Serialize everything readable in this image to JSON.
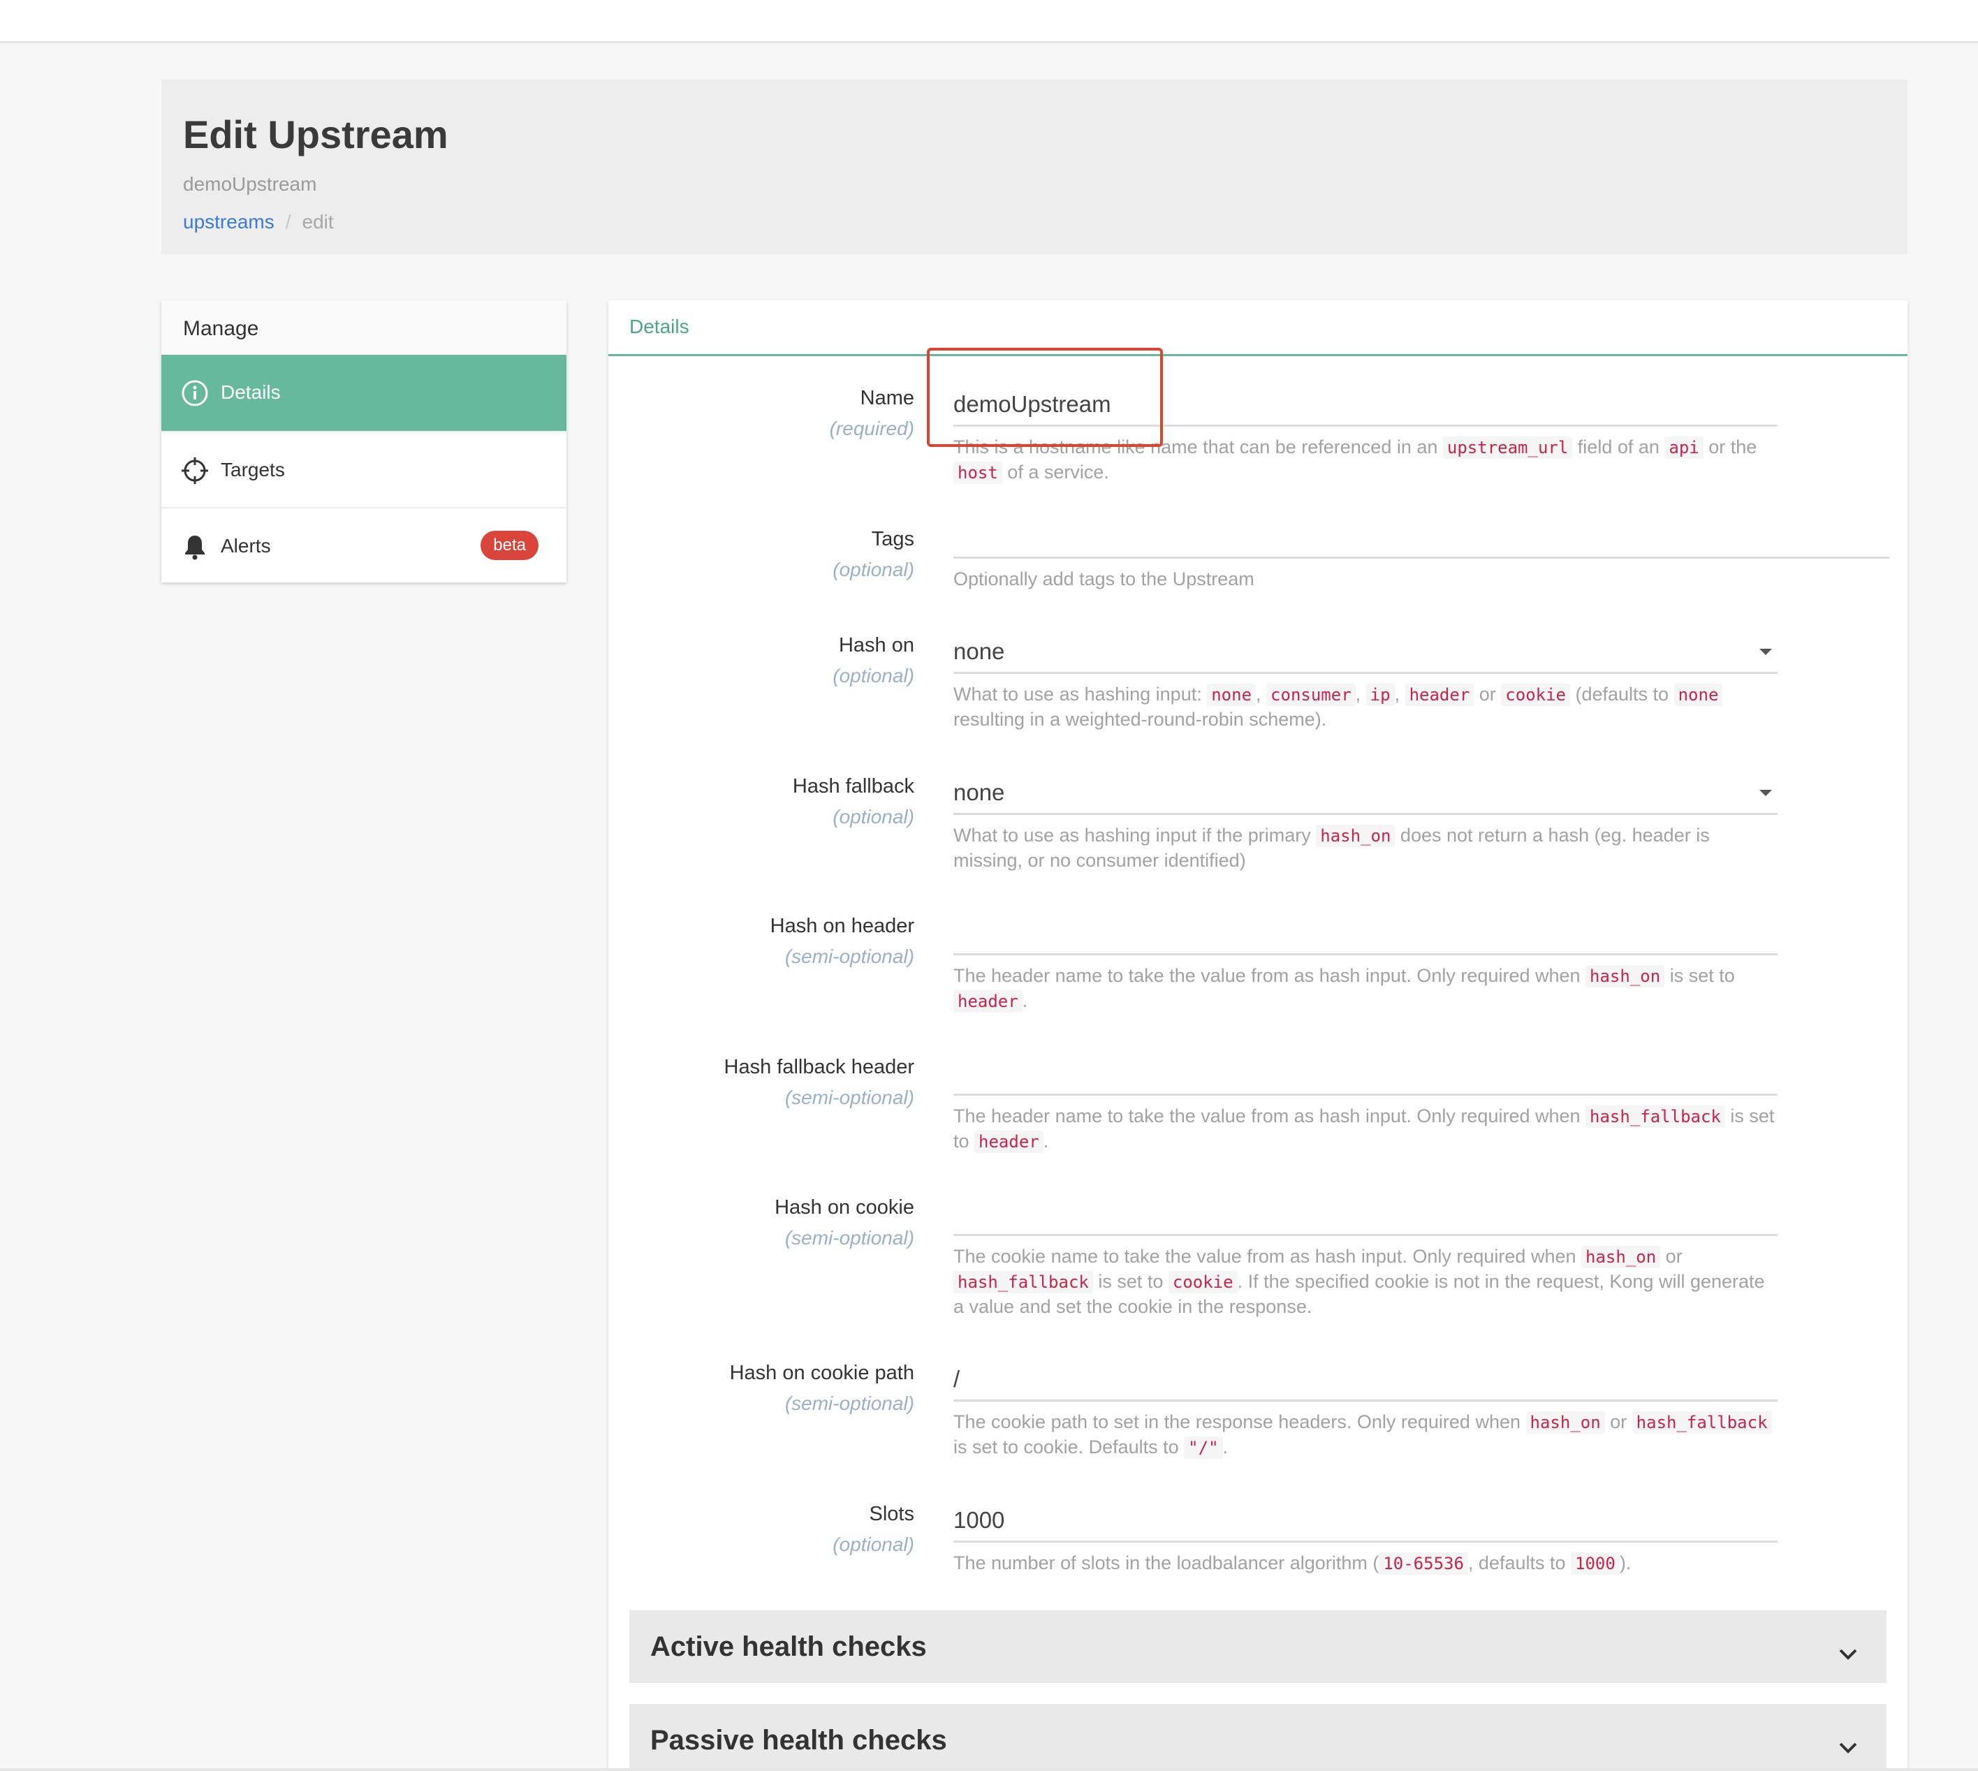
{
  "header": {
    "title": "Edit Upstream",
    "subtitle": "demoUpstream",
    "breadcrumb": {
      "link": "upstreams",
      "separator": "/",
      "current": "edit"
    }
  },
  "sidebar": {
    "heading": "Manage",
    "items": [
      {
        "label": "Details",
        "icon": "info-icon",
        "active": true
      },
      {
        "label": "Targets",
        "icon": "crosshair-icon"
      },
      {
        "label": "Alerts",
        "icon": "bell-icon",
        "badge": "beta"
      }
    ]
  },
  "tab": {
    "label": "Details"
  },
  "fields": {
    "name": {
      "label": "Name",
      "req": "(required)",
      "value": "demoUpstream",
      "help": [
        "This is a hostname like name that can be referenced in an ",
        "upstream_url",
        " field of an ",
        "api",
        " or the ",
        "host",
        " of a service."
      ]
    },
    "tags": {
      "label": "Tags",
      "req": "(optional)",
      "value": "",
      "help": "Optionally add tags to the Upstream"
    },
    "hash_on": {
      "label": "Hash on",
      "req": "(optional)",
      "value": "none",
      "help": [
        "What to use as hashing input: ",
        "none",
        ", ",
        "consumer",
        ", ",
        "ip",
        ", ",
        "header",
        " or ",
        "cookie",
        " (defaults to ",
        "none",
        " resulting in a weighted-round-robin scheme)."
      ]
    },
    "hash_fallback": {
      "label": "Hash fallback",
      "req": "(optional)",
      "value": "none",
      "help": [
        "What to use as hashing input if the primary ",
        "hash_on",
        " does not return a hash (eg. header is missing, or no consumer identified)"
      ]
    },
    "hash_on_header": {
      "label": "Hash on header",
      "req": "(semi-optional)",
      "value": "",
      "help": [
        "The header name to take the value from as hash input. Only required when ",
        "hash_on",
        " is set to ",
        "header",
        "."
      ]
    },
    "hash_fallback_header": {
      "label": "Hash fallback header",
      "req": "(semi-optional)",
      "value": "",
      "help": [
        "The header name to take the value from as hash input. Only required when ",
        "hash_fallback",
        " is set to ",
        "header",
        "."
      ]
    },
    "hash_on_cookie": {
      "label": "Hash on cookie",
      "req": "(semi-optional)",
      "value": "",
      "help": [
        "The cookie name to take the value from as hash input. Only required when ",
        "hash_on",
        " or ",
        "hash_fallback",
        " is set to ",
        "cookie",
        ". If the specified cookie is not in the request, Kong will generate a value and set the cookie in the response."
      ]
    },
    "hash_on_cookie_path": {
      "label": "Hash on cookie path",
      "req": "(semi-optional)",
      "value": "/",
      "help": [
        "The cookie path to set in the response headers. Only required when ",
        "hash_on",
        " or ",
        "hash_fallback",
        " is set to cookie. Defaults to ",
        "\"/\"",
        "."
      ]
    },
    "slots": {
      "label": "Slots",
      "req": "(optional)",
      "value": "1000",
      "help": [
        "The number of slots in the loadbalancer algorithm (",
        "10-65536",
        ", defaults to ",
        "1000",
        ")."
      ]
    }
  },
  "sections": {
    "active": "Active health checks",
    "passive": "Passive health checks"
  },
  "colors": {
    "accent": "#66b99d",
    "link": "#3b7ad6",
    "badge": "#d9453b",
    "highlight": "#d9452f",
    "code": "#c7254e"
  }
}
